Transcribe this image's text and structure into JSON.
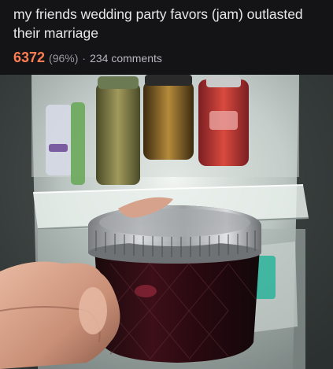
{
  "post": {
    "title": "my friends wedding party favors (jam) outlasted their marriage",
    "score": "6372",
    "upvote_ratio": "(96%)",
    "separator": "·",
    "comments": "234 comments"
  },
  "image": {
    "subject": "jam-jar-photo"
  }
}
